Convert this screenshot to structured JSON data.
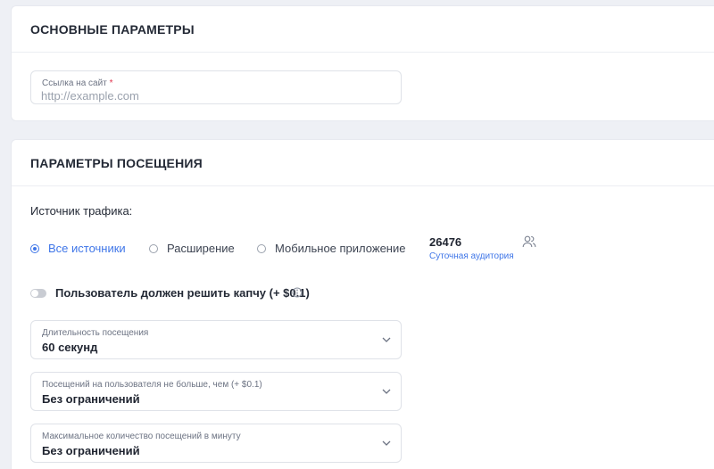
{
  "basic": {
    "title": "ОСНОВНЫЕ ПАРАМЕТРЫ",
    "site_link": {
      "label": "Ссылка на сайт",
      "required_mark": "*",
      "placeholder": "http://example.com",
      "value": ""
    }
  },
  "visit": {
    "title": "ПАРАМЕТРЫ ПОСЕЩЕНИЯ",
    "traffic_source": {
      "label": "Источник трафика:",
      "options": [
        {
          "label": "Все источники",
          "selected": true
        },
        {
          "label": "Расширение",
          "selected": false
        },
        {
          "label": "Мобильное приложение",
          "selected": false
        }
      ],
      "audience": {
        "value": "26476",
        "label": "Суточная аудитория",
        "icon": "users-icon"
      }
    },
    "captcha": {
      "label": "Пользователь должен решить капчу (+ $0.1)",
      "enabled": false,
      "icon": "info-icon"
    },
    "duration": {
      "label": "Длительность посещения",
      "value": "60 секунд"
    },
    "max_per_user": {
      "label": "Посещений на пользователя не больше, чем (+ $0.1)",
      "value": "Без ограничений"
    },
    "max_per_minute": {
      "label": "Максимальное количество посещений в минуту",
      "value": "Без ограничений"
    }
  },
  "colors": {
    "accent": "#3f76e8",
    "required": "#e0324b",
    "background": "#eef0f5"
  }
}
